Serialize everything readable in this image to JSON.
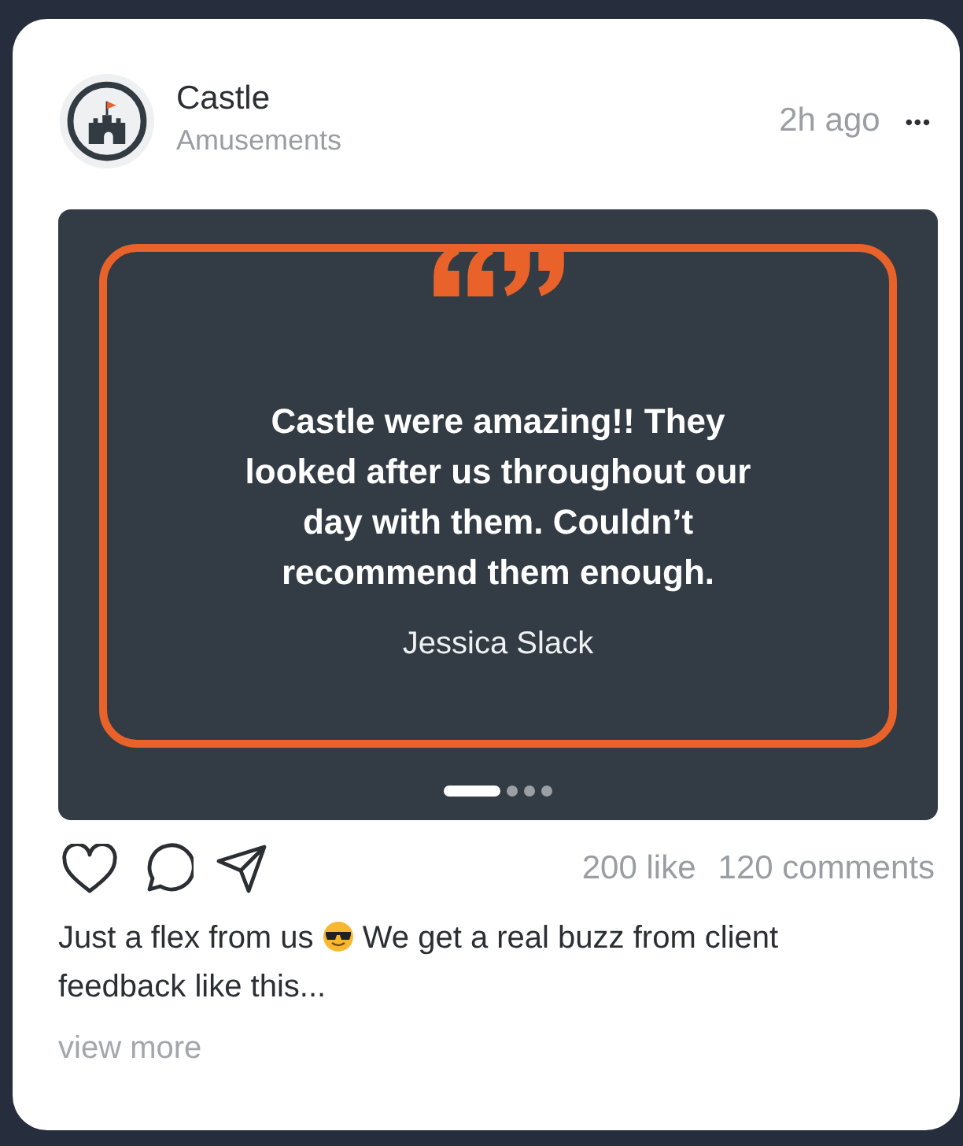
{
  "post": {
    "author": "Castle",
    "subtitle": "Amusements",
    "time": "2h ago",
    "menu": "•••"
  },
  "slide": {
    "quote": "Castle were amazing!! They looked after us throughout our day with them. Couldn’t recommend them enough.",
    "name": "Jessica Slack"
  },
  "dots": [
    {
      "selected": true
    },
    {
      "selected": false
    },
    {
      "selected": false
    },
    {
      "selected": false
    }
  ],
  "stats": {
    "likes": "200 like",
    "comments": "120 comments"
  },
  "caption": {
    "before": "Just a flex from us",
    "after": "We get a real buzz from client",
    "continued": "feedback like this..."
  },
  "view_more": "view more"
}
